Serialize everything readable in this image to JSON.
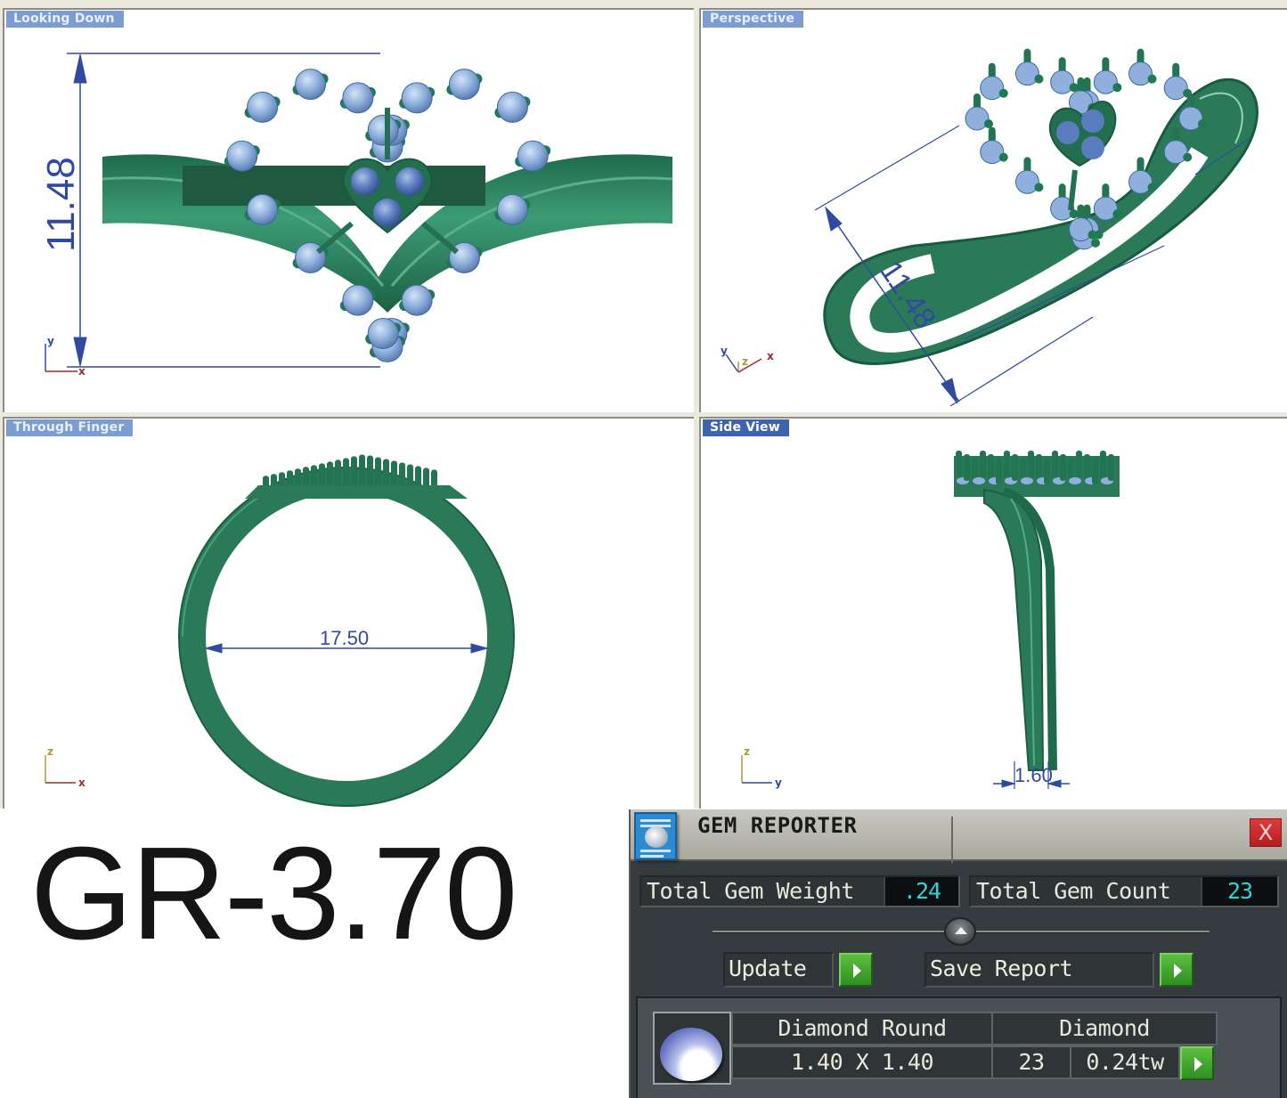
{
  "viewports": {
    "top_left": {
      "label": "Looking Down",
      "active": false,
      "dimension": "11.48",
      "axes": {
        "vertical": "y",
        "horizontal": "x"
      }
    },
    "top_right": {
      "label": "Perspective",
      "active": false,
      "dimension": "11.48",
      "axes": {
        "a": "y",
        "b": "z",
        "c": "x"
      }
    },
    "bottom_left": {
      "label": "Through Finger",
      "active": false,
      "dimension": "17.50",
      "axes": {
        "vertical": "z",
        "horizontal": "x"
      }
    },
    "bottom_right": {
      "label": "Side View",
      "active": true,
      "dimension": "1.60",
      "axes": {
        "vertical": "z",
        "horizontal": "y"
      }
    }
  },
  "model_code": "GR-3.70",
  "gem_reporter": {
    "title": "GEM REPORTER",
    "close_label": "X",
    "total_weight_label": "Total Gem Weight",
    "total_weight_value": ".24",
    "total_count_label": "Total Gem Count",
    "total_count_value": "23",
    "update_label": "Update",
    "save_report_label": "Save Report",
    "gems": [
      {
        "shape": "Diamond Round",
        "material": "Diamond",
        "size": "1.40 X 1.40",
        "count": "23",
        "weight": "0.24tw"
      }
    ]
  },
  "colors": {
    "metal": "#2a7a58",
    "stone": "#8fb0dc",
    "dimension": "#2f4aa0",
    "axis_x": "#a32a2a",
    "axis_y": "#2f4aa0",
    "axis_z": "#a59d3a",
    "accent_value": "#33d1d6",
    "go_button": "#3fa52d",
    "close_button": "#cf2a2a"
  }
}
